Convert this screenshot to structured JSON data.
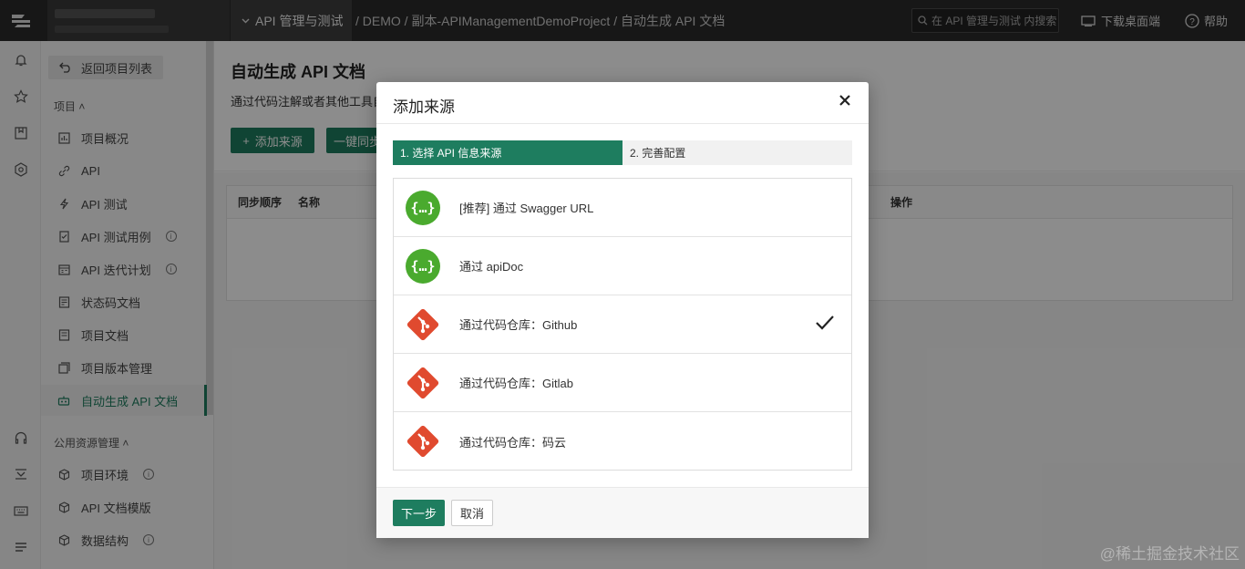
{
  "topbar": {
    "project_menu": "API 管理与测试",
    "breadcrumb": "/ DEMO / 副本-APIManagementDemoProject / 自动生成 API 文档",
    "search_placeholder": "在 API 管理与测试 内搜索",
    "download_label": "下载桌面端",
    "help_label": "帮助"
  },
  "sidebar": {
    "back_label": "返回项目列表",
    "section_project": "项目",
    "items": [
      {
        "label": "项目概况",
        "icon": "dashboard-icon"
      },
      {
        "label": "API",
        "icon": "link-icon"
      },
      {
        "label": "API 测试",
        "icon": "lightning-icon"
      },
      {
        "label": "API 测试用例",
        "icon": "checklist-icon",
        "info": true
      },
      {
        "label": "API 迭代计划",
        "icon": "calendar-icon",
        "info": true
      },
      {
        "label": "状态码文档",
        "icon": "document-icon"
      },
      {
        "label": "项目文档",
        "icon": "file-icon"
      },
      {
        "label": "项目版本管理",
        "icon": "versions-icon"
      },
      {
        "label": "自动生成 API 文档",
        "icon": "robot-icon"
      }
    ],
    "section_public": "公用资源管理",
    "public_items": [
      {
        "label": "项目环境",
        "icon": "cube-icon",
        "info": true
      },
      {
        "label": "API 文档模版",
        "icon": "cube-icon"
      },
      {
        "label": "数据结构",
        "icon": "cube-icon",
        "info": true
      }
    ],
    "info_glyph": "i"
  },
  "main": {
    "title": "自动生成 API 文档",
    "description": "通过代码注解或者其他工具自动",
    "add_button": "添加来源",
    "sync_button": "一键同步",
    "columns": [
      "同步顺序",
      "名称",
      "操作"
    ]
  },
  "modal": {
    "title": "添加来源",
    "steps": [
      "1. 选择 API 信息来源",
      "2. 完善配置"
    ],
    "options": [
      {
        "label": "[推荐] 通过 Swagger URL",
        "icon": "swagger-icon",
        "selected": false
      },
      {
        "label": "通过 apiDoc",
        "icon": "swagger-icon",
        "selected": false
      },
      {
        "label": "通过代码仓库：Github",
        "icon": "git-icon",
        "selected": true
      },
      {
        "label": "通过代码仓库：Gitlab",
        "icon": "git-icon",
        "selected": false
      },
      {
        "label": "通过代码仓库：码云",
        "icon": "git-icon",
        "selected": false
      }
    ],
    "next_button": "下一步",
    "cancel_button": "取消"
  },
  "watermark": "@稀土掘金技术社区",
  "colors": {
    "primary": "#1e7d5f",
    "swagger": "#4aaa2e",
    "git": "#e04a2f",
    "topbar": "#2b2b2b"
  }
}
